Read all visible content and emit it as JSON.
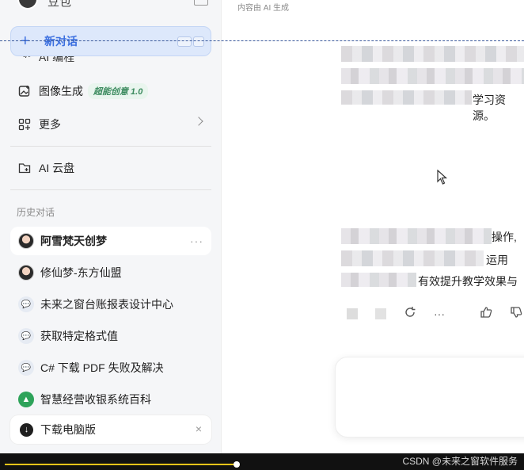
{
  "user": {
    "name": "豆包"
  },
  "sidebar": {
    "new_chat_label": "新对话",
    "partial_item_label": "AI 编程",
    "items": [
      {
        "label": "图像生成",
        "badge": "超能创意 1.0"
      },
      {
        "label": "更多"
      },
      {
        "label": "AI 云盘"
      }
    ],
    "history_title": "历史对话",
    "history": [
      {
        "label": "阿雪梵天创梦",
        "active": true
      },
      {
        "label": "修仙梦-东方仙盟"
      },
      {
        "label": "未来之窗台账报表设计中心"
      },
      {
        "label": "获取特定格式值"
      },
      {
        "label": "C# 下载 PDF 失败及解决"
      },
      {
        "label": "智慧经营收银系统百科"
      }
    ],
    "history_more": "···",
    "download_label": "下载电脑版",
    "download_close": "×"
  },
  "main": {
    "ai_note": "内容由 AI 生成",
    "fragments": [
      "学习资源。",
      "操作,",
      "运用",
      "有效提升教学效果与"
    ],
    "actions": [
      "···"
    ]
  },
  "footer": {
    "watermark": "CSDN @未来之窗软件服务",
    "progress": 0.45
  },
  "colors": {
    "accent": "#3b6fe0",
    "progress": "#f0c419"
  }
}
